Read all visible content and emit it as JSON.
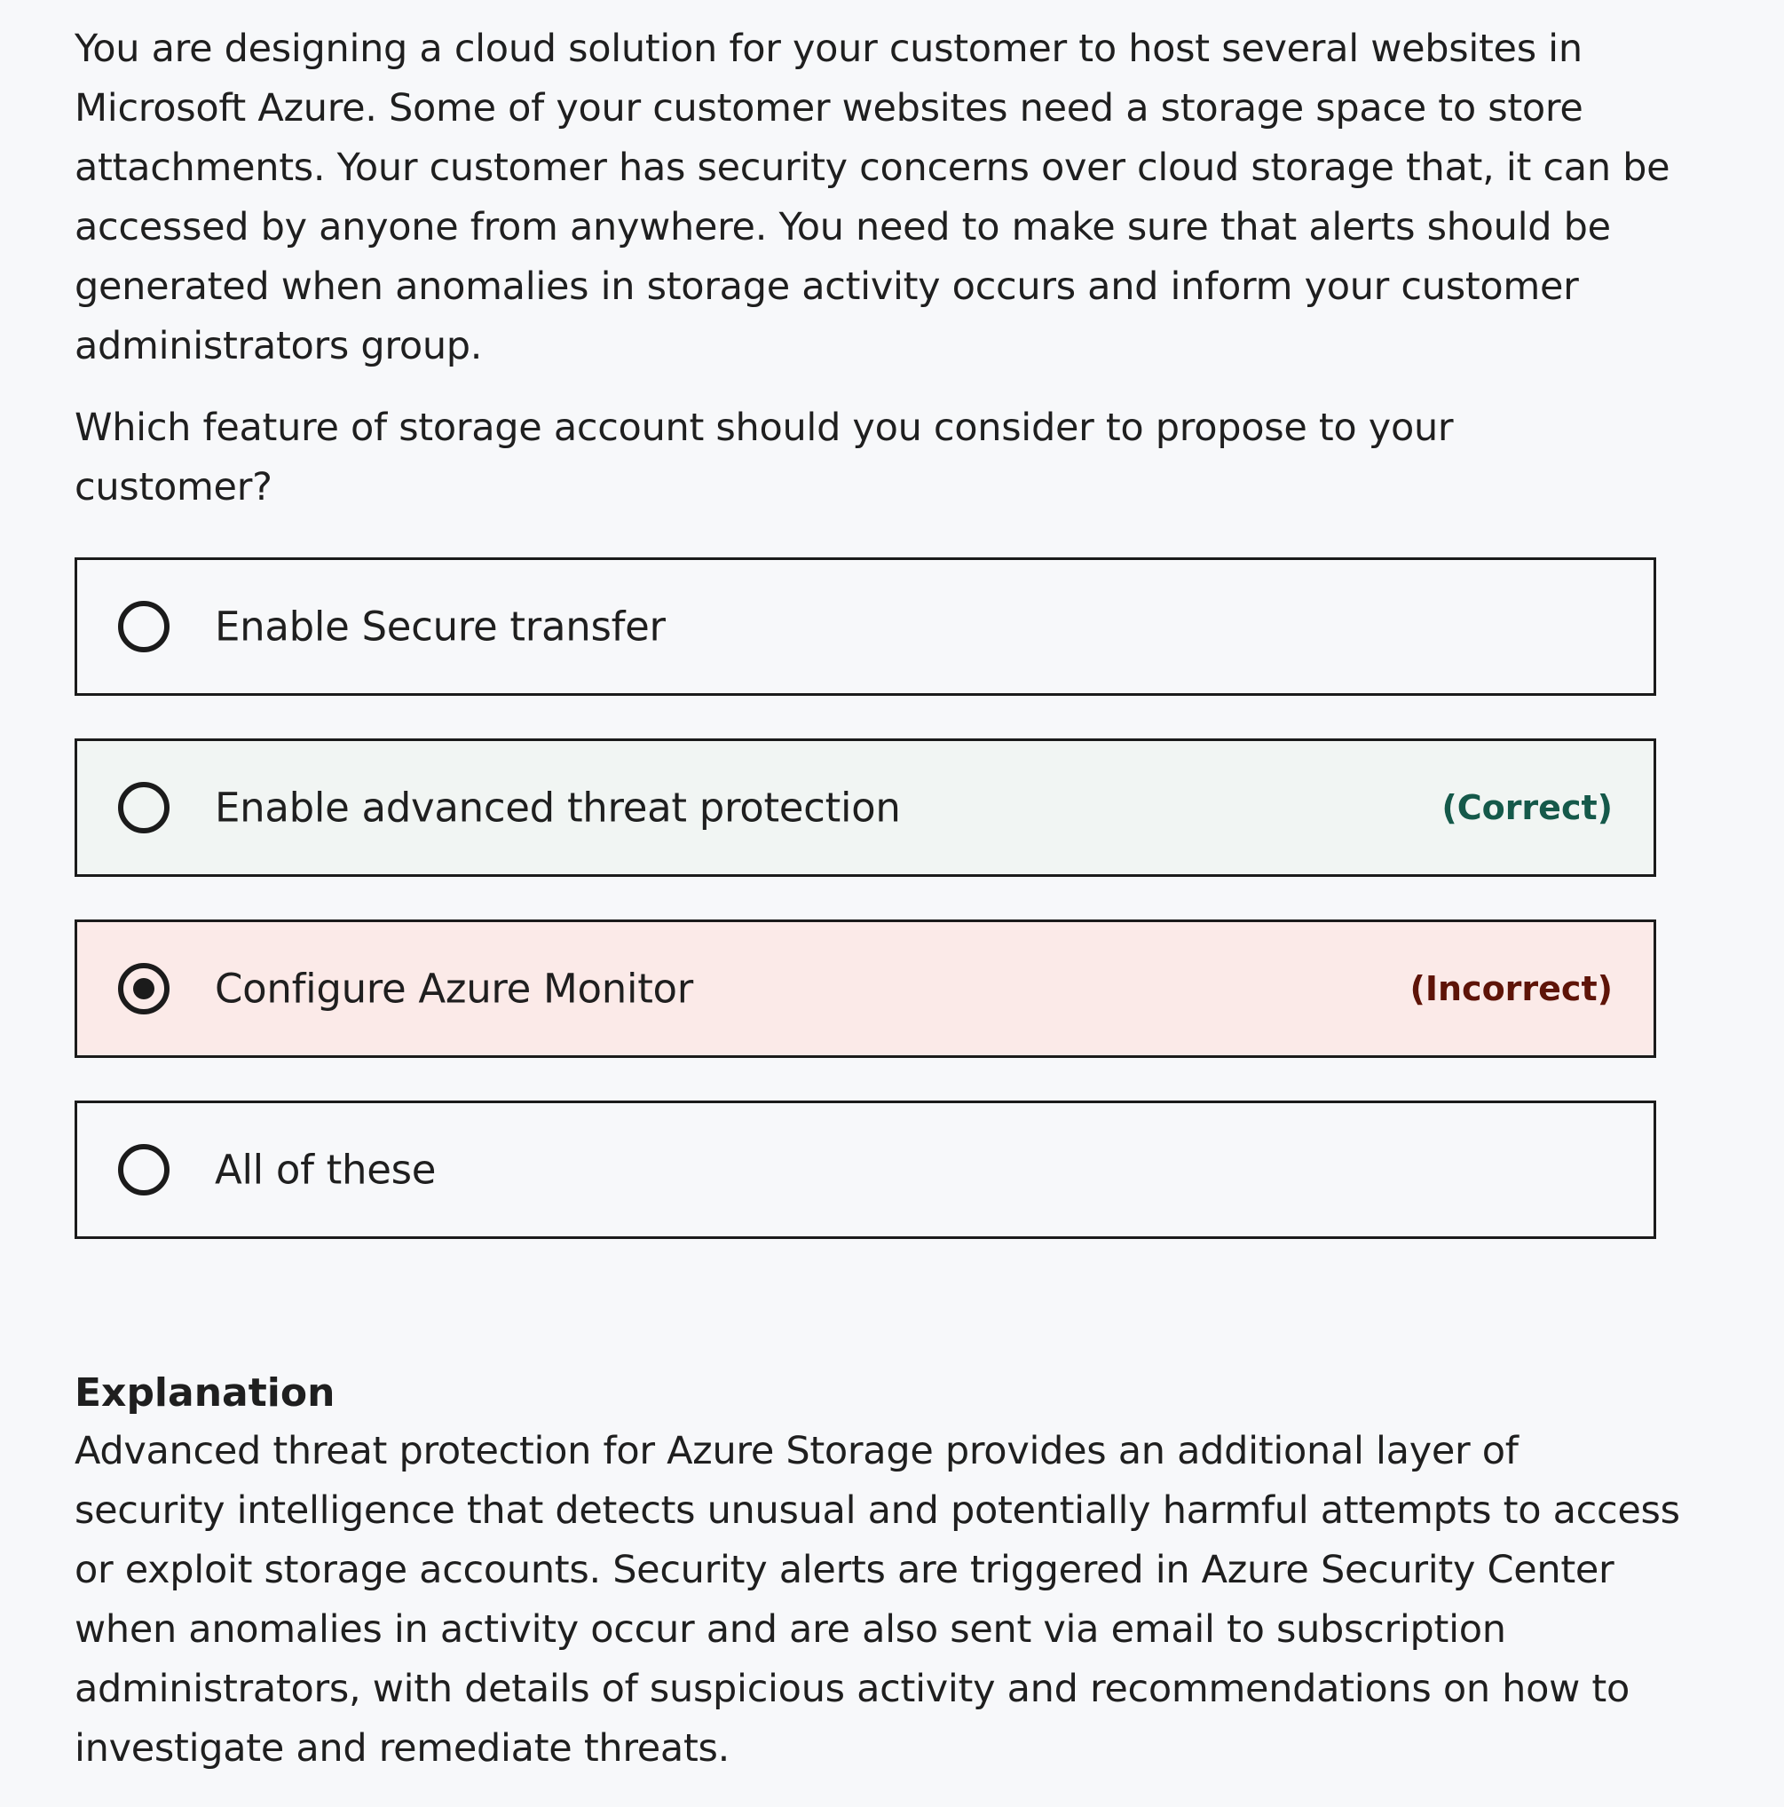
{
  "question": {
    "paragraph1": "You are designing a cloud solution for your customer to host several websites in\nMicrosoft Azure. Some of your customer websites need a storage space to store\nattachments. Your customer has security concerns over cloud storage that, it can be\naccessed by anyone from anywhere. You need to make sure that alerts should be\ngenerated when anomalies in storage activity occurs and inform your customer\nadministrators group.",
    "paragraph2": "Which feature of storage account should you consider to propose to your\ncustomer?"
  },
  "options": [
    {
      "label": "Enable Secure transfer",
      "status": "",
      "selected": false
    },
    {
      "label": "Enable advanced threat protection",
      "status": "(Correct)",
      "selected": false
    },
    {
      "label": "Configure Azure Monitor",
      "status": "(Incorrect)",
      "selected": true
    },
    {
      "label": "All of these",
      "status": "",
      "selected": false
    }
  ],
  "explanation": {
    "title": "Explanation",
    "body": "Advanced threat protection for Azure Storage provides an additional layer of\nsecurity intelligence that detects unusual and potentially harmful attempts to access\nor exploit storage accounts. Security alerts are triggered in Azure Security Center\nwhen anomalies in activity occur and are also sent via email to subscription\nadministrators, with details of suspicious activity and recommendations on how to\ninvestigate and remediate threats."
  },
  "colors": {
    "correct_text": "#15594a",
    "incorrect_text": "#5e1408",
    "correct_bg": "#f1f5f3",
    "incorrect_bg": "#fbeae8",
    "page_bg": "#f7f8fa"
  }
}
